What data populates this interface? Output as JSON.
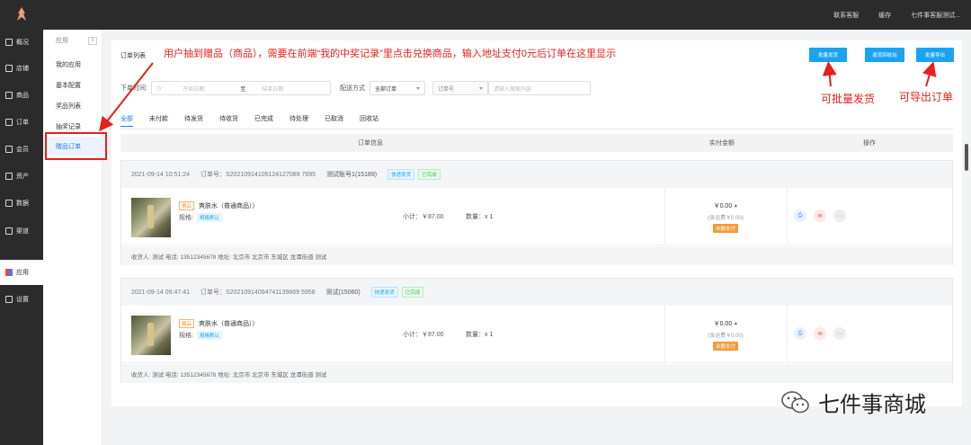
{
  "topbar": {
    "links": [
      "联系客服",
      "缓存",
      "七件事客服测试..."
    ]
  },
  "leftnav": [
    {
      "label": "概况",
      "icon": "overview-icon"
    },
    {
      "label": "店铺",
      "icon": "store-icon"
    },
    {
      "label": "商品",
      "icon": "goods-icon"
    },
    {
      "label": "订单",
      "icon": "order-icon"
    },
    {
      "label": "会员",
      "icon": "member-icon"
    },
    {
      "label": "资产",
      "icon": "asset-icon"
    },
    {
      "label": "数据",
      "icon": "data-icon"
    },
    {
      "label": "渠道",
      "icon": "channel-icon"
    },
    {
      "label": "应用",
      "icon": "apps-icon"
    },
    {
      "label": "设置",
      "icon": "settings-icon"
    }
  ],
  "subnav": {
    "head": "应用",
    "collapse": "≡",
    "items": [
      "我的应用",
      "基本配置",
      "奖品列表",
      "抽奖记录",
      "赠品订单"
    ]
  },
  "panel": {
    "title": "订单列表",
    "buttons": {
      "batch_ship": "批量发货",
      "recycle": "退货回收站",
      "export": "批量导出"
    }
  },
  "filters": {
    "time_label": "下单时间:",
    "start_placeholder": "开始日期",
    "to": "至",
    "end_placeholder": "结束日期",
    "ship_label": "配送方式",
    "ship_value": "全部订单",
    "field_value": "订单号",
    "search_placeholder": "请输入搜索内容"
  },
  "tabs": [
    "全部",
    "未付款",
    "待发货",
    "待收货",
    "已完成",
    "待处理",
    "已取消",
    "回收站"
  ],
  "table_headers": [
    "订单信息",
    "实付金额",
    "操作"
  ],
  "orders": [
    {
      "time": "2021-09-14 10:51:24",
      "order_no": "订单号：S20210914105124127089 7695",
      "account": "测试账号1(15189)",
      "ship_tag": "快递发货",
      "status_tag": "已完成",
      "type_tag": "赠品",
      "product": "爽肤水（普通商品））",
      "spec_label": "规格:",
      "spec": "规格默认",
      "subtotal": "小计：￥87.00",
      "qty": "数量：x 1",
      "amount": "￥0.00",
      "freight": "(含运费￥0.00)",
      "pay": "余额支付",
      "address": "收货人: 测试  电话: 13512345678  地址: 北京市 北京市 东城区 龙潭街道 测试"
    },
    {
      "time": "2021-09-14 09:47:41",
      "order_no": "订单号：S20210914094741139869 5958",
      "account": "测试(15060)",
      "ship_tag": "快递发货",
      "status_tag": "已完成",
      "type_tag": "赠品",
      "product": "爽肤水（普通商品））",
      "spec_label": "规格:",
      "spec": "规格默认",
      "subtotal": "小计：￥87.00",
      "qty": "数量：x 1",
      "amount": "￥0.00",
      "freight": "(含运费￥0.00)",
      "pay": "余额支付",
      "address": "收货人: 测试  电话: 13512345678  地址: 北京市 北京市 东城区 龙潭街道 测试"
    }
  ],
  "annotations": {
    "main": "用户抽到赠品（商品），需要在前端“我的中奖记录”里点击兑换商品，输入地址支付0元后订单在这里显示",
    "batch": "可批量发货",
    "export": "可导出订单"
  },
  "watermark": "七件事商城",
  "colors": {
    "accent": "#1aa3f5",
    "annotation": "#e8201a",
    "nav_bg": "#2b2b2b"
  }
}
